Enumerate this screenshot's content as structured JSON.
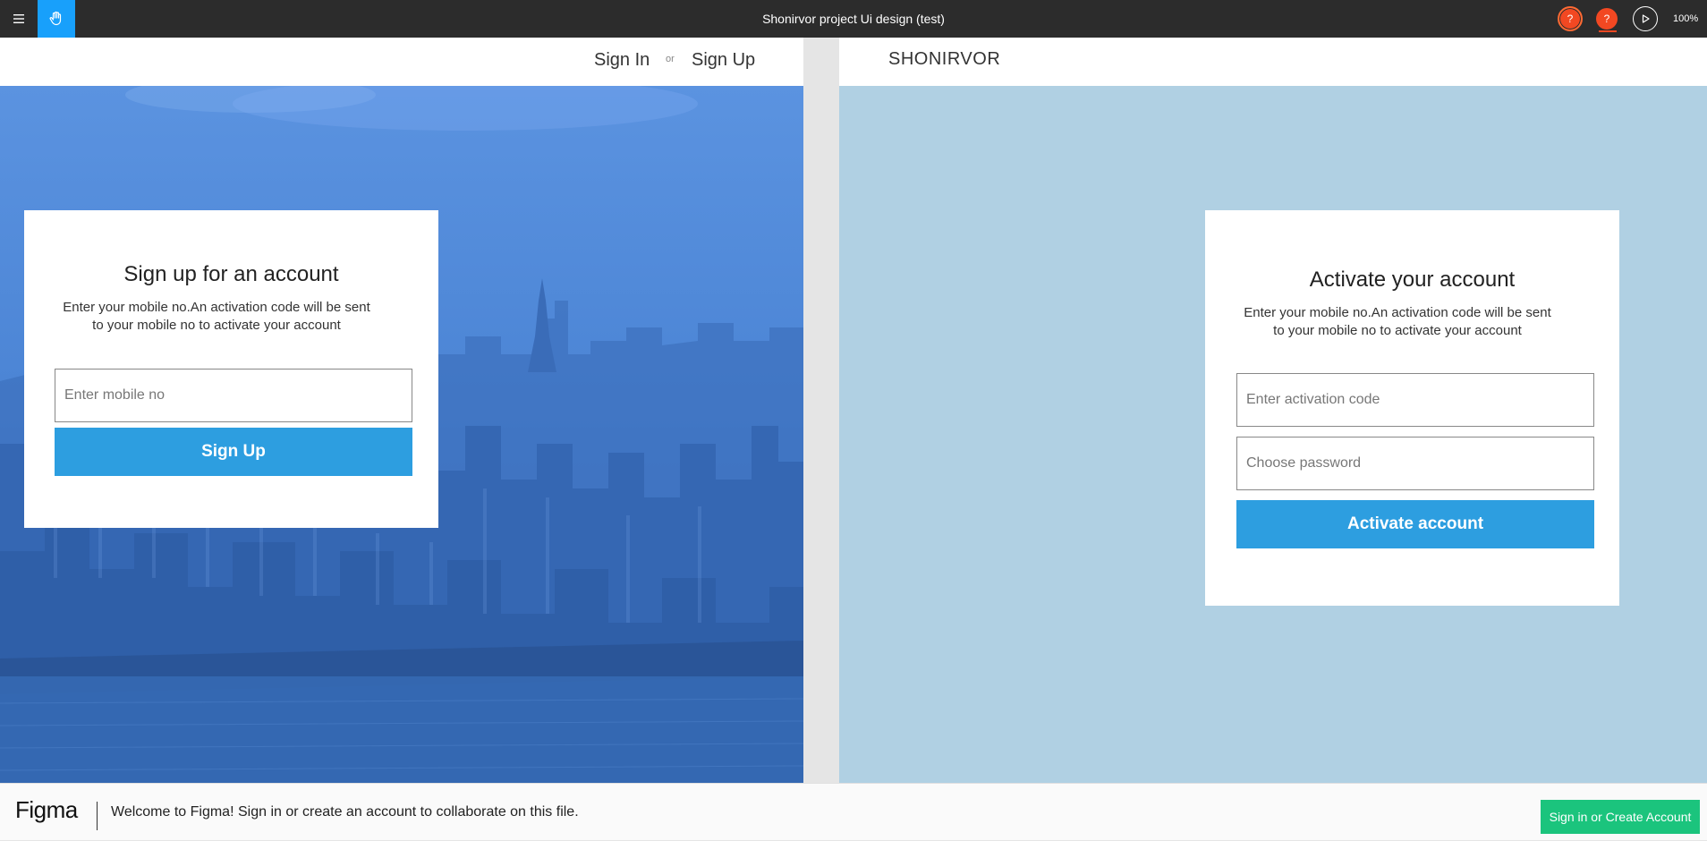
{
  "toolbar": {
    "title": "Shonirvor project Ui design (test)",
    "avatar_1": "?",
    "avatar_2": "?",
    "zoom": "100%"
  },
  "frame1": {
    "nav": {
      "sign_in": "Sign In",
      "or": "or",
      "sign_up": "Sign Up"
    },
    "card": {
      "title": "Sign up for an account",
      "desc_line1": "Enter your mobile no.An activation code will be sent",
      "desc_line2": "to your mobile no to activate your account",
      "mobile_placeholder": "Enter mobile no",
      "button": "Sign Up"
    }
  },
  "frame2": {
    "logo": "SHONIRVOR",
    "card": {
      "title": "Activate your account",
      "desc_line1": "Enter your mobile no.An activation code will be sent",
      "desc_line2": "to your mobile no to activate your account",
      "code_placeholder": "Enter activation code",
      "password_placeholder": "Choose password",
      "button": "Activate account"
    }
  },
  "banner": {
    "logo": "Figma",
    "message": "Welcome to Figma! Sign in or create an account to collaborate on this file.",
    "button": "Sign in or Create Account"
  },
  "colors": {
    "toolbar": "#2c2c2c",
    "accent": "#18a0fb",
    "primary_button": "#2d9ee0",
    "banner_button": "#1bc47d",
    "avatar": "#f24822",
    "frame2_background": "#b0d0e3"
  },
  "icons": {
    "menu": "hamburger-icon",
    "hand": "hand-tool-icon",
    "play": "play-icon",
    "zoom_dropdown": "chevron-down-icon"
  }
}
